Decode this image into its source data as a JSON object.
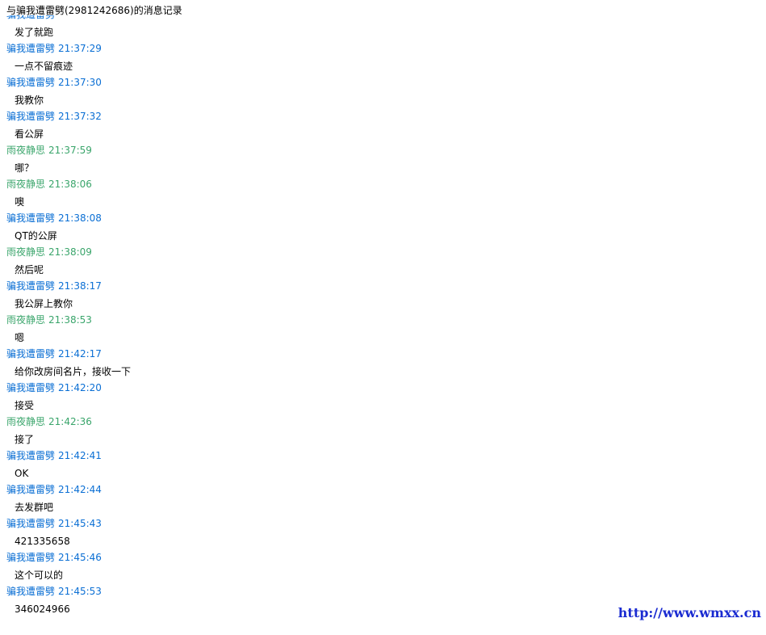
{
  "window": {
    "title": "与骗我遭雷劈(2981242686)的消息记录"
  },
  "colors": {
    "contact_a": "#0b6fd4",
    "contact_b": "#3aa56b",
    "watermark": "#1a2bd1"
  },
  "log": {
    "messages": [
      {
        "sender": "骗我遭雷劈",
        "time": "",
        "body": "发了就跑",
        "color": "blue"
      },
      {
        "sender": "骗我遭雷劈",
        "time": "21:37:29",
        "body": "一点不留痕迹",
        "color": "blue"
      },
      {
        "sender": "骗我遭雷劈",
        "time": "21:37:30",
        "body": "我教你",
        "color": "blue"
      },
      {
        "sender": "骗我遭雷劈",
        "time": "21:37:32",
        "body": "看公屏",
        "color": "blue"
      },
      {
        "sender": "雨夜静思",
        "time": "21:37:59",
        "body": "哪？",
        "color": "green"
      },
      {
        "sender": "雨夜静思",
        "time": "21:38:06",
        "body": "噢",
        "color": "green"
      },
      {
        "sender": "骗我遭雷劈",
        "time": "21:38:08",
        "body": "QT的公屏",
        "color": "blue"
      },
      {
        "sender": "雨夜静思",
        "time": "21:38:09",
        "body": "然后呢",
        "color": "green"
      },
      {
        "sender": "骗我遭雷劈",
        "time": "21:38:17",
        "body": "我公屏上教你",
        "color": "blue"
      },
      {
        "sender": "雨夜静思",
        "time": "21:38:53",
        "body": "嗯",
        "color": "green"
      },
      {
        "sender": "骗我遭雷劈",
        "time": "21:42:17",
        "body": "给你改房间名片，接收一下",
        "color": "blue"
      },
      {
        "sender": "骗我遭雷劈",
        "time": "21:42:20",
        "body": "接受",
        "color": "blue"
      },
      {
        "sender": "雨夜静思",
        "time": "21:42:36",
        "body": "接了",
        "color": "green"
      },
      {
        "sender": "骗我遭雷劈",
        "time": "21:42:41",
        "body": "OK",
        "color": "blue"
      },
      {
        "sender": "骗我遭雷劈",
        "time": "21:42:44",
        "body": "去发群吧",
        "color": "blue"
      },
      {
        "sender": "骗我遭雷劈",
        "time": "21:45:43",
        "body": "421335658",
        "color": "blue"
      },
      {
        "sender": "骗我遭雷劈",
        "time": "21:45:46",
        "body": "这个可以的",
        "color": "blue"
      },
      {
        "sender": "骗我遭雷劈",
        "time": "21:45:53",
        "body": "346024966",
        "color": "blue"
      }
    ]
  },
  "watermark": {
    "text": "http://www.wmxx.cn"
  }
}
